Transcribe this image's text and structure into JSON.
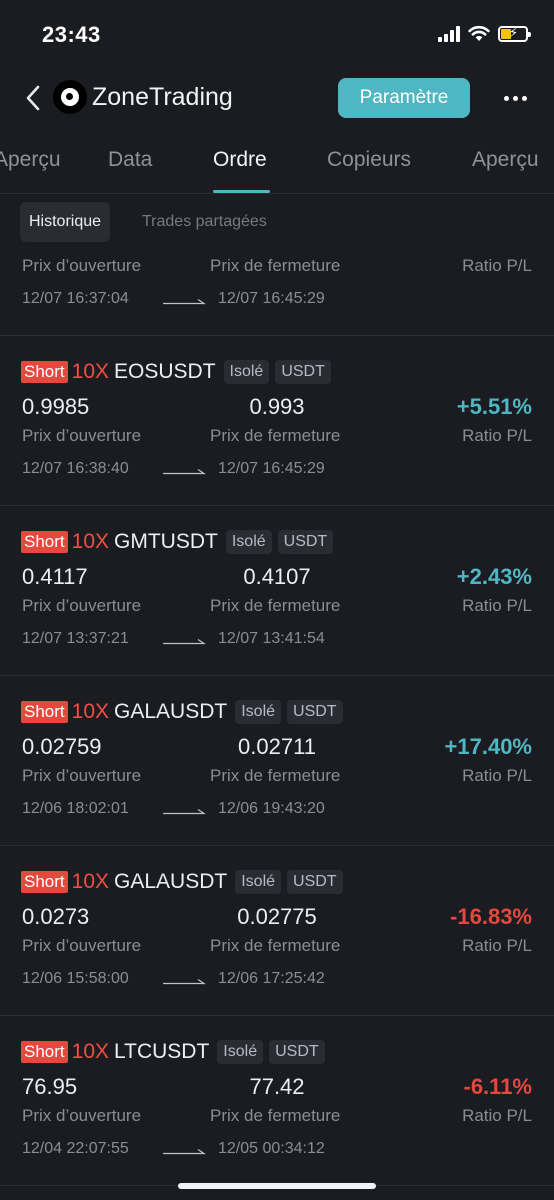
{
  "status": {
    "time": "23:43"
  },
  "header": {
    "title": "ZoneTrading",
    "button": "Paramètre"
  },
  "tabs": [
    "Aperçu",
    "Data",
    "Ordre",
    "Copieurs",
    "Aperçu"
  ],
  "subtabs": [
    "Historique",
    "Trades partagées"
  ],
  "labels": {
    "open": "Prix d’ouverture",
    "close": "Prix de fermeture",
    "ratio": "Ratio P/L"
  },
  "partial_card": {
    "open_time": "12/07 16:37:04",
    "close_time": "12/07 16:45:29"
  },
  "trades": [
    {
      "side": "Short",
      "leverage": "10X",
      "symbol": "EOSUSDT",
      "margin": "Isolé",
      "quote": "USDT",
      "open_price": "0.9985",
      "close_price": "0.993",
      "ratio": "+5.51%",
      "open_time": "12/07 16:38:40",
      "close_time": "12/07 16:45:29"
    },
    {
      "side": "Short",
      "leverage": "10X",
      "symbol": "GMTUSDT",
      "margin": "Isolé",
      "quote": "USDT",
      "open_price": "0.4117",
      "close_price": "0.4107",
      "ratio": "+2.43%",
      "open_time": "12/07 13:37:21",
      "close_time": "12/07 13:41:54"
    },
    {
      "side": "Short",
      "leverage": "10X",
      "symbol": "GALAUSDT",
      "margin": "Isolé",
      "quote": "USDT",
      "open_price": "0.02759",
      "close_price": "0.02711",
      "ratio": "+17.40%",
      "open_time": "12/06 18:02:01",
      "close_time": "12/06 19:43:20"
    },
    {
      "side": "Short",
      "leverage": "10X",
      "symbol": "GALAUSDT",
      "margin": "Isolé",
      "quote": "USDT",
      "open_price": "0.0273",
      "close_price": "0.02775",
      "ratio": "-16.83%",
      "open_time": "12/06 15:58:00",
      "close_time": "12/06 17:25:42"
    },
    {
      "side": "Short",
      "leverage": "10X",
      "symbol": "LTCUSDT",
      "margin": "Isolé",
      "quote": "USDT",
      "open_price": "76.95",
      "close_price": "77.42",
      "ratio": "-6.11%",
      "open_time": "12/04 22:07:55",
      "close_time": "12/05 00:34:12"
    }
  ],
  "colors": {
    "accent": "#4fb7c3",
    "loss": "#e5483d",
    "background": "#1b1c21"
  }
}
